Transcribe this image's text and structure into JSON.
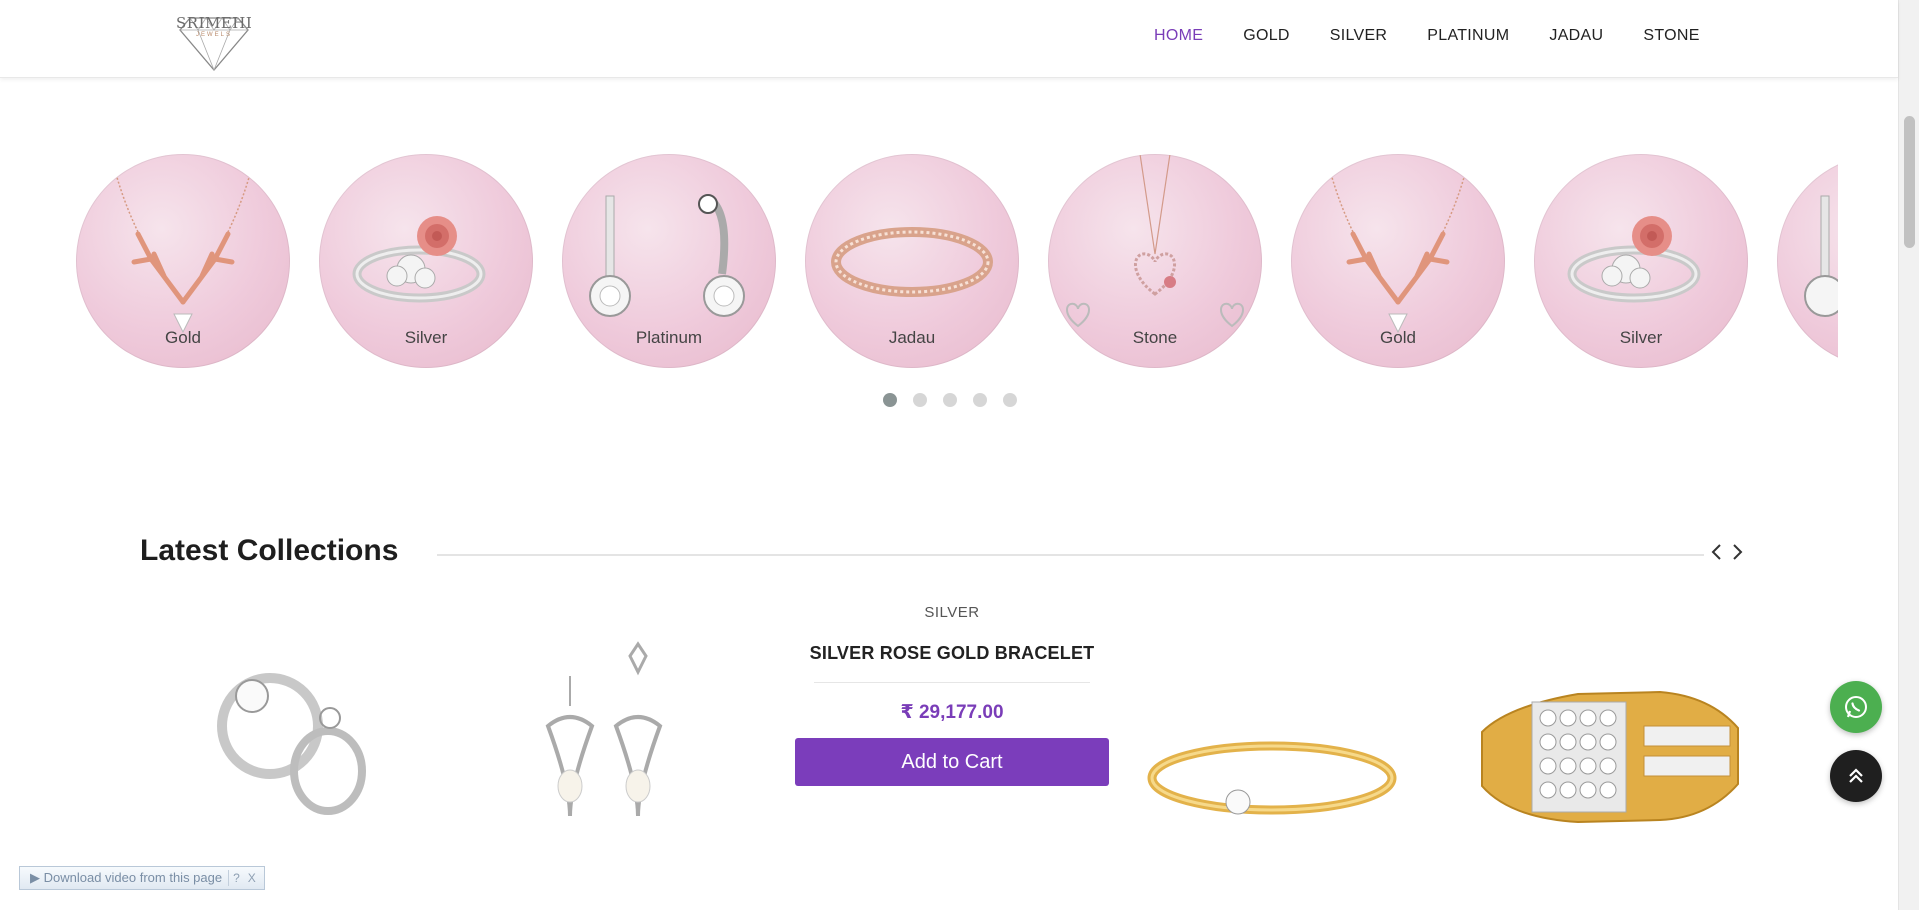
{
  "header": {
    "logo": {
      "text": "SRIMEHI",
      "sub": "JEWELS"
    },
    "nav": [
      {
        "label": "HOME",
        "active": true
      },
      {
        "label": "GOLD",
        "active": false
      },
      {
        "label": "SILVER",
        "active": false
      },
      {
        "label": "PLATINUM",
        "active": false
      },
      {
        "label": "JADAU",
        "active": false
      },
      {
        "label": "STONE",
        "active": false
      }
    ]
  },
  "categories": [
    {
      "label": "Gold",
      "icon": "antler-necklace"
    },
    {
      "label": "Silver",
      "icon": "rose-ring"
    },
    {
      "label": "Platinum",
      "icon": "drop-earrings"
    },
    {
      "label": "Jadau",
      "icon": "bangle"
    },
    {
      "label": "Stone",
      "icon": "heart-pendant"
    },
    {
      "label": "Gold",
      "icon": "antler-necklace"
    },
    {
      "label": "Silver",
      "icon": "rose-ring"
    }
  ],
  "carousel": {
    "dots": 5,
    "active_dot": 1
  },
  "latest": {
    "title": "Latest Collections",
    "prev_icon": "chevron-left-icon",
    "next_icon": "chevron-right-icon",
    "featured": {
      "category": "SILVER",
      "title": "SILVER ROSE GOLD BRACELET",
      "price": "₹ 29,177.00",
      "button": "Add to Cart"
    }
  },
  "floating": {
    "whatsapp_icon": "whatsapp-icon",
    "top_icon": "double-chevron-up-icon"
  },
  "download_bar": {
    "label": "▶ Download video from this page",
    "help": "?",
    "close": "X"
  },
  "colors": {
    "accent": "#7b3dbb",
    "whatsapp": "#4caf50"
  }
}
